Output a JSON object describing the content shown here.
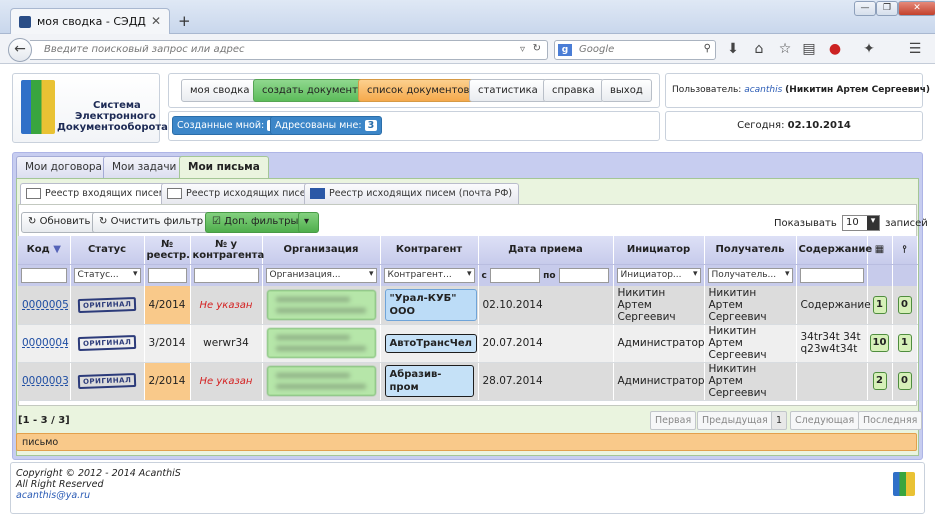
{
  "browser": {
    "tab_title": "моя сводка - СЭДД",
    "new_tab": "+",
    "url_placeholder": "Введите поисковый запрос или адрес",
    "search_engine": "Google",
    "search_placeholder": "Google",
    "win_minimize": "—",
    "win_restore": "❐",
    "win_close": "✕"
  },
  "logo": {
    "line1": "Системa",
    "line2": "Электронного",
    "line3": "Документооборота"
  },
  "menu": {
    "summary": "моя сводка",
    "create": "создать документ",
    "list": "список документов",
    "stats": "статистика",
    "help": "справка",
    "exit": "выход"
  },
  "user": {
    "label": "Пользователь:",
    "login": "acanthis",
    "full_name": "(Никитин Артем Сергеевич)"
  },
  "counters": {
    "created_label": "Созданные мной:",
    "created_count": "1",
    "addressed_label": "Адресованы мне:",
    "addressed_count": "3"
  },
  "today": {
    "label": "Сегодня:",
    "value": "02.10.2014"
  },
  "main_tabs": [
    "Мои договора",
    "Мои задачи",
    "Мои письма"
  ],
  "sub_tabs": [
    "Реестр входящих писем",
    "Реестр исходящих писем",
    "Реестр исходящих писем (почта РФ)"
  ],
  "toolbar": {
    "refresh": "Обновить",
    "clear_filter": "Очистить фильтр",
    "more_filters": "Доп. фильтры",
    "show_label": "Показывать",
    "page_size": "10",
    "records_label": "записей"
  },
  "columns": {
    "code": "Код",
    "status": "Статус",
    "reg_no": "№ реестр.",
    "contr_no": "№ у контрагента",
    "org": "Организация",
    "contractor": "Контрагент",
    "date": "Дата приема",
    "initiator": "Инициатор",
    "recipient": "Получатель",
    "content": "Содержание"
  },
  "filters": {
    "status": "Статус...",
    "org": "Организация...",
    "contractor": "Контрагент...",
    "date_from": "с",
    "date_to": "по",
    "initiator": "Инициатор...",
    "recipient": "Получатель..."
  },
  "rows": [
    {
      "code": "0000005",
      "status": "ОРИГИНАЛ",
      "reg": "4/2014",
      "contr_no": "Не указан",
      "contractor": "\"Урал-КУБ\" ООО",
      "date": "02.10.2014",
      "initiator": "Никитин Артем Сергеевич",
      "recipient": "Никитин Артем Сергеевич",
      "content": "Содержание",
      "n1": "1",
      "n2": "0"
    },
    {
      "code": "0000004",
      "status": "ОРИГИНАЛ",
      "reg": "3/2014",
      "contr_no": "werwr34",
      "contractor": "АвтоТрансЧел",
      "date": "20.07.2014",
      "initiator": "Администратор",
      "recipient": "Никитин Артем Сергеевич",
      "content": "34tr34t 34tq23w4t34t",
      "n1": "10",
      "n2": "1"
    },
    {
      "code": "0000003",
      "status": "ОРИГИНАЛ",
      "reg": "2/2014",
      "contr_no": "Не указан",
      "contractor": "Абразив-пром",
      "date": "28.07.2014",
      "initiator": "Администратор",
      "recipient": "Никитин Артем Сергеевич",
      "content": "",
      "n1": "2",
      "n2": "0"
    }
  ],
  "pagination": {
    "range": "[1 - 3 / 3]",
    "first": "Первая",
    "prev": "Предыдущая",
    "current": "1",
    "next": "Следующая",
    "last": "Последняя"
  },
  "note": "письмо",
  "footer": {
    "copyright": "Copyright © 2012 - 2014 AcanthiS",
    "rights": "All Right Reserved",
    "email": "acanthis@ya.ru"
  },
  "colors": {
    "accent_green": "#5cbc5a",
    "accent_orange": "#f5a94c",
    "link_blue": "#1f4ea3",
    "badge_blue": "#3c86c8"
  }
}
